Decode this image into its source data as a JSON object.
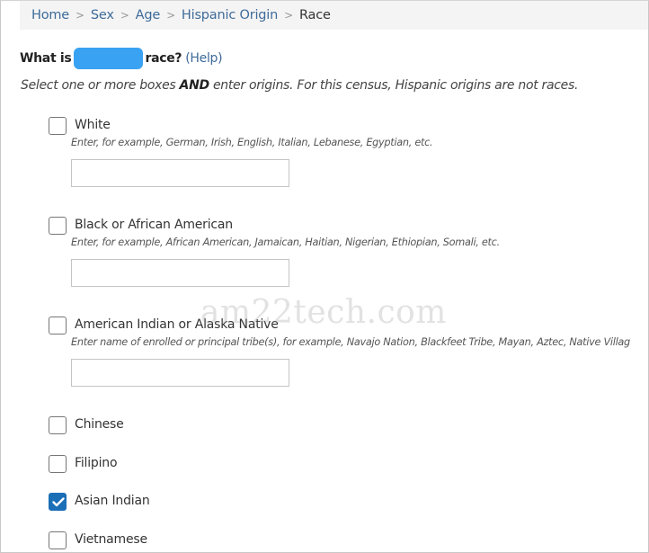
{
  "breadcrumb": {
    "items": [
      {
        "label": "Home"
      },
      {
        "label": "Sex"
      },
      {
        "label": "Age"
      },
      {
        "label": "Hispanic Origin"
      }
    ],
    "separator": ">",
    "current": "Race"
  },
  "question": {
    "prefix": "What is",
    "suffix": "race?",
    "help_label": "(Help)"
  },
  "instructions": {
    "part1": "Select one or more boxes ",
    "emphasis": "AND",
    "part2": " enter origins. For this census, Hispanic origins are not races."
  },
  "options": [
    {
      "label": "White",
      "checked": false,
      "hint": "Enter, for example, German, Irish, English, Italian, Lebanese, Egyptian, etc.",
      "input_value": ""
    },
    {
      "label": "Black or African American",
      "checked": false,
      "hint": "Enter, for example, African American, Jamaican, Haitian, Nigerian, Ethiopian, Somali, etc.",
      "input_value": ""
    },
    {
      "label": "American Indian or Alaska Native",
      "checked": false,
      "hint": "Enter name of enrolled or principal tribe(s), for example, Navajo Nation, Blackfeet Tribe, Mayan, Aztec, Native Villag",
      "input_value": ""
    },
    {
      "label": "Chinese",
      "checked": false
    },
    {
      "label": "Filipino",
      "checked": false
    },
    {
      "label": "Asian Indian",
      "checked": true
    },
    {
      "label": "Vietnamese",
      "checked": false
    }
  ],
  "watermark": "am22tech.com",
  "colors": {
    "link": "#3e6b99",
    "checkbox_checked": "#1a6fb7",
    "redaction": "#3aa2f2",
    "breadcrumb_bg": "#f4f4f4"
  }
}
